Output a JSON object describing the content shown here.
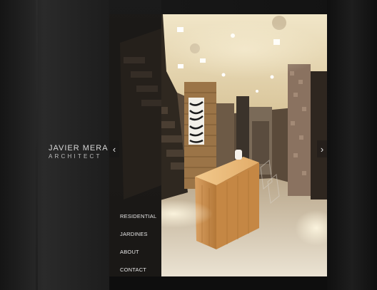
{
  "brand": {
    "name": "JAVIER MERA",
    "subtitle": "ARCHITECT"
  },
  "navigation": {
    "items": [
      {
        "label": "RESIDENTIAL"
      },
      {
        "label": "JARDINES"
      },
      {
        "label": "ABOUT"
      },
      {
        "label": "CONTACT"
      }
    ]
  },
  "gallery": {
    "prev_icon": "chevron-left-icon",
    "next_icon": "chevron-right-icon",
    "photo_subject": "interior-kitchen-with-wood-island"
  },
  "colors": {
    "background": "#111111",
    "brand_text": "#d7d7d7",
    "nav_text": "#e6e6e6",
    "wood": "#c9924f"
  }
}
